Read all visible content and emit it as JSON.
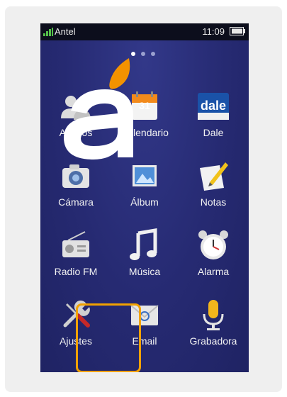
{
  "status_bar": {
    "carrier": "Antel",
    "time": "11:09"
  },
  "home": {
    "page_indicator": {
      "count": 3,
      "active_index": 0
    },
    "apps": [
      {
        "label": "Amigos",
        "icon": "contacts-icon"
      },
      {
        "label": "Calendario",
        "icon": "calendar-icon",
        "badge": "31"
      },
      {
        "label": "Dale",
        "icon": "dale-icon",
        "badge": "dale"
      },
      {
        "label": "Cámara",
        "icon": "camera-icon"
      },
      {
        "label": "Álbum",
        "icon": "album-icon"
      },
      {
        "label": "Notas",
        "icon": "notes-icon"
      },
      {
        "label": "Radio FM",
        "icon": "radio-icon"
      },
      {
        "label": "Música",
        "icon": "music-icon"
      },
      {
        "label": "Alarma",
        "icon": "alarm-icon"
      },
      {
        "label": "Ajustes",
        "icon": "settings-icon",
        "highlighted": true
      },
      {
        "label": "Email",
        "icon": "email-icon"
      },
      {
        "label": "Grabadora",
        "icon": "recorder-icon"
      }
    ]
  },
  "overlay_logo": {
    "letter": "a",
    "icon": "antel-logo"
  },
  "colors": {
    "screen_bg": "#262a72",
    "highlight": "#f2a200",
    "logo_orange": "#f39200"
  }
}
